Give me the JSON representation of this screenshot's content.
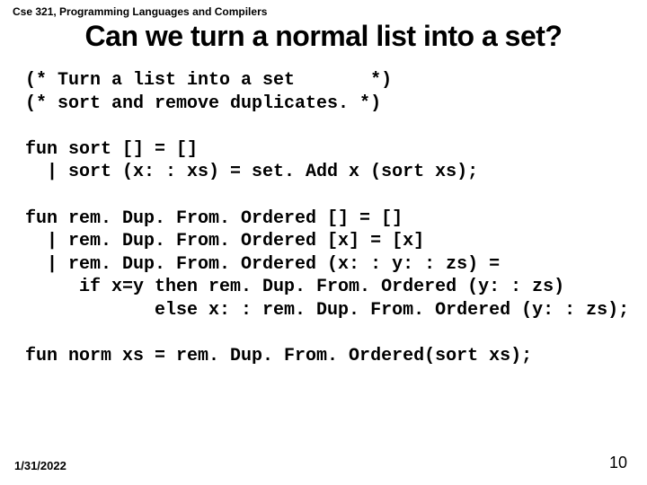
{
  "course_header": "Cse 321, Programming Languages and Compilers",
  "title": "Can we turn a normal list into a set?",
  "code_lines": [
    "(* Turn a list into a set       *)",
    "(* sort and remove duplicates. *)",
    "",
    "fun sort [] = []",
    "  | sort (x: : xs) = set. Add x (sort xs);",
    "",
    "fun rem. Dup. From. Ordered [] = []",
    "  | rem. Dup. From. Ordered [x] = [x]",
    "  | rem. Dup. From. Ordered (x: : y: : zs) =",
    "     if x=y then rem. Dup. From. Ordered (y: : zs)",
    "            else x: : rem. Dup. From. Ordered (y: : zs);",
    "",
    "fun norm xs = rem. Dup. From. Ordered(sort xs);"
  ],
  "footer": {
    "date": "1/31/2022",
    "page": "10"
  }
}
